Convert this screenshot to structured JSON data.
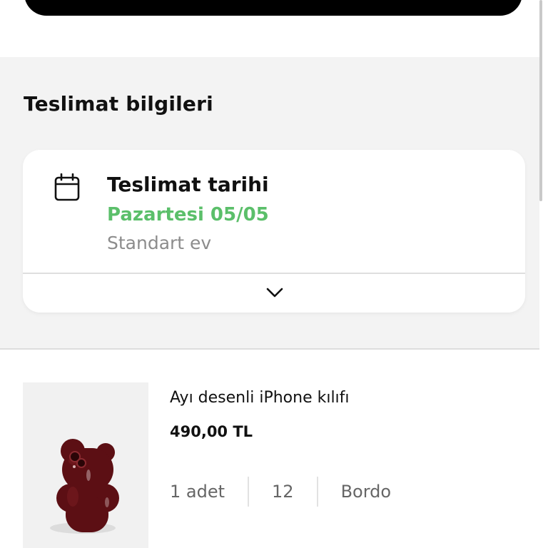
{
  "delivery": {
    "section_title": "Teslimat bilgileri",
    "card": {
      "icon": "calendar-icon",
      "title": "Teslimat tarihi",
      "date": "Pazartesi 05/05",
      "type": "Standart ev",
      "expand_icon": "chevron-down-icon"
    }
  },
  "product": {
    "name": "Ayı desenli iPhone kılıfı",
    "price": "490,00 TL",
    "quantity": "1 adet",
    "size": "12",
    "color": "Bordo"
  },
  "colors": {
    "date_accent": "#5bbf6a",
    "section_background": "#f3f3f3",
    "product_color": "#5c0f14"
  }
}
